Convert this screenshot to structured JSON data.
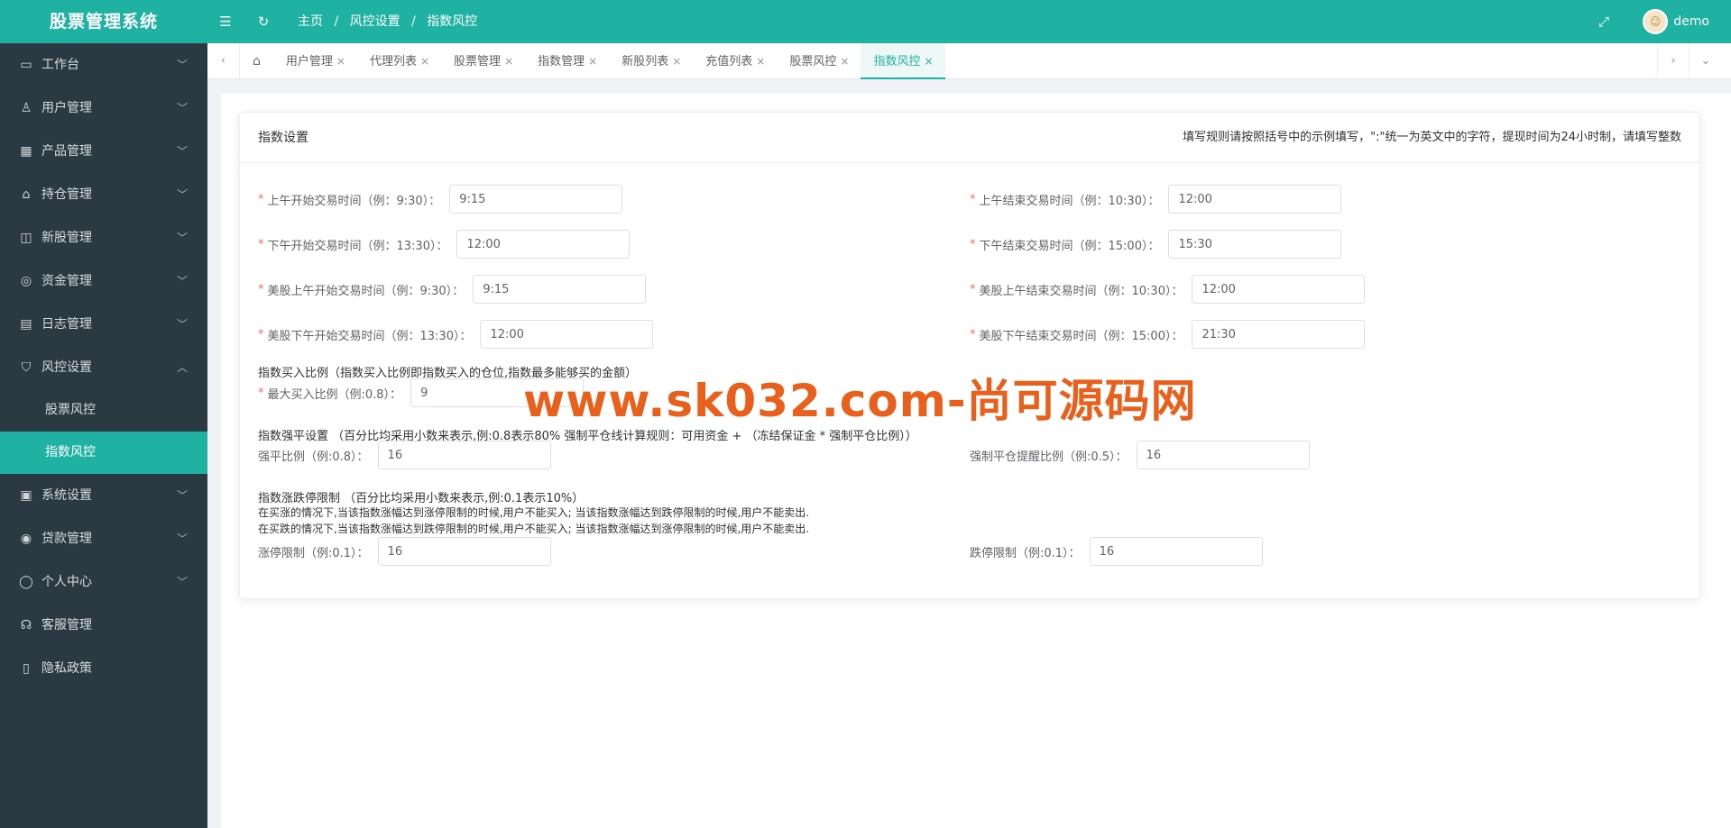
{
  "app": {
    "title": "股票管理系统"
  },
  "breadcrumb": [
    "主页",
    "风控设置",
    "指数风控"
  ],
  "user": {
    "name": "demo"
  },
  "sidebar": {
    "items": [
      {
        "label": "工作台",
        "icon": "monitor-icon"
      },
      {
        "label": "用户管理",
        "icon": "user-icon"
      },
      {
        "label": "产品管理",
        "icon": "grid-icon"
      },
      {
        "label": "持仓管理",
        "icon": "home-icon"
      },
      {
        "label": "新股管理",
        "icon": "chart-icon"
      },
      {
        "label": "资金管理",
        "icon": "coins-icon"
      },
      {
        "label": "日志管理",
        "icon": "log-icon"
      },
      {
        "label": "风控设置",
        "icon": "shield-icon"
      }
    ],
    "sub_items": [
      {
        "label": "股票风控",
        "active": false
      },
      {
        "label": "指数风控",
        "active": true
      }
    ],
    "items_after": [
      {
        "label": "系统设置",
        "icon": "settings-icon"
      },
      {
        "label": "贷款管理",
        "icon": "loan-icon"
      },
      {
        "label": "个人中心",
        "icon": "person-icon"
      },
      {
        "label": "客服管理",
        "icon": "service-icon"
      },
      {
        "label": "隐私政策",
        "icon": "privacy-icon"
      }
    ]
  },
  "tabs": [
    {
      "label": "用户管理"
    },
    {
      "label": "代理列表"
    },
    {
      "label": "股票管理"
    },
    {
      "label": "指数管理"
    },
    {
      "label": "新股列表"
    },
    {
      "label": "充值列表"
    },
    {
      "label": "股票风控"
    },
    {
      "label": "指数风控",
      "active": true
    }
  ],
  "card": {
    "title": "指数设置",
    "rule": "填写规则请按照括号中的示例填写，\":\"统一为英文中的字符，提现时间为24小时制，请填写整数"
  },
  "form": {
    "am_start": {
      "label": "上午开始交易时间（例：9:30）：",
      "value": "9:15"
    },
    "am_end": {
      "label": "上午结束交易时间（例：10:30）：",
      "value": "12:00"
    },
    "pm_start": {
      "label": "下午开始交易时间（例：13:30）：",
      "value": "12:00"
    },
    "pm_end": {
      "label": "下午结束交易时间（例：15:00）：",
      "value": "15:30"
    },
    "us_am_start": {
      "label": "美股上午开始交易时间（例：9:30）：",
      "value": "9:15"
    },
    "us_am_end": {
      "label": "美股上午结束交易时间（例：10:30）：",
      "value": "12:00"
    },
    "us_pm_start": {
      "label": "美股下午开始交易时间（例：13:30）：",
      "value": "12:00"
    },
    "us_pm_end": {
      "label": "美股下午结束交易时间（例：15:00）：",
      "value": "21:30"
    },
    "buy_ratio_title": "指数买入比例（指数买入比例即指数买入的仓位,指数最多能够买的金额）",
    "max_buy": {
      "label": "最大买入比例（例:0.8）：",
      "value": "9"
    },
    "force_title": "指数强平设置 （百分比均采用小数来表示,例:0.8表示80% 强制平仓线计算规则：可用资金 + （冻结保证金 * 强制平仓比例））",
    "force_ratio": {
      "label": "强平比例（例:0.8）：",
      "value": "16"
    },
    "force_remind": {
      "label": "强制平仓提醒比例（例:0.5）：",
      "value": "16"
    },
    "limit_title": "指数涨跌停限制 （百分比均采用小数来表示,例:0.1表示10%）",
    "limit_note1": "在买涨的情况下,当该指数涨幅达到涨停限制的时候,用户不能买入; 当该指数涨幅达到跌停限制的时候,用户不能卖出.",
    "limit_note2": "在买跌的情况下,当该指数涨幅达到跌停限制的时候,用户不能买入; 当该指数涨幅达到涨停限制的时候,用户不能卖出.",
    "up_limit": {
      "label": "涨停限制（例:0.1）：",
      "value": "16"
    },
    "down_limit": {
      "label": "跌停限制（例:0.1）：",
      "value": "16"
    }
  },
  "watermark": "www.sk032.com-尚可源码网",
  "colors": {
    "accent": "#1fb2a3",
    "sidebar": "#2b3a42",
    "watermark": "#e8601c"
  }
}
